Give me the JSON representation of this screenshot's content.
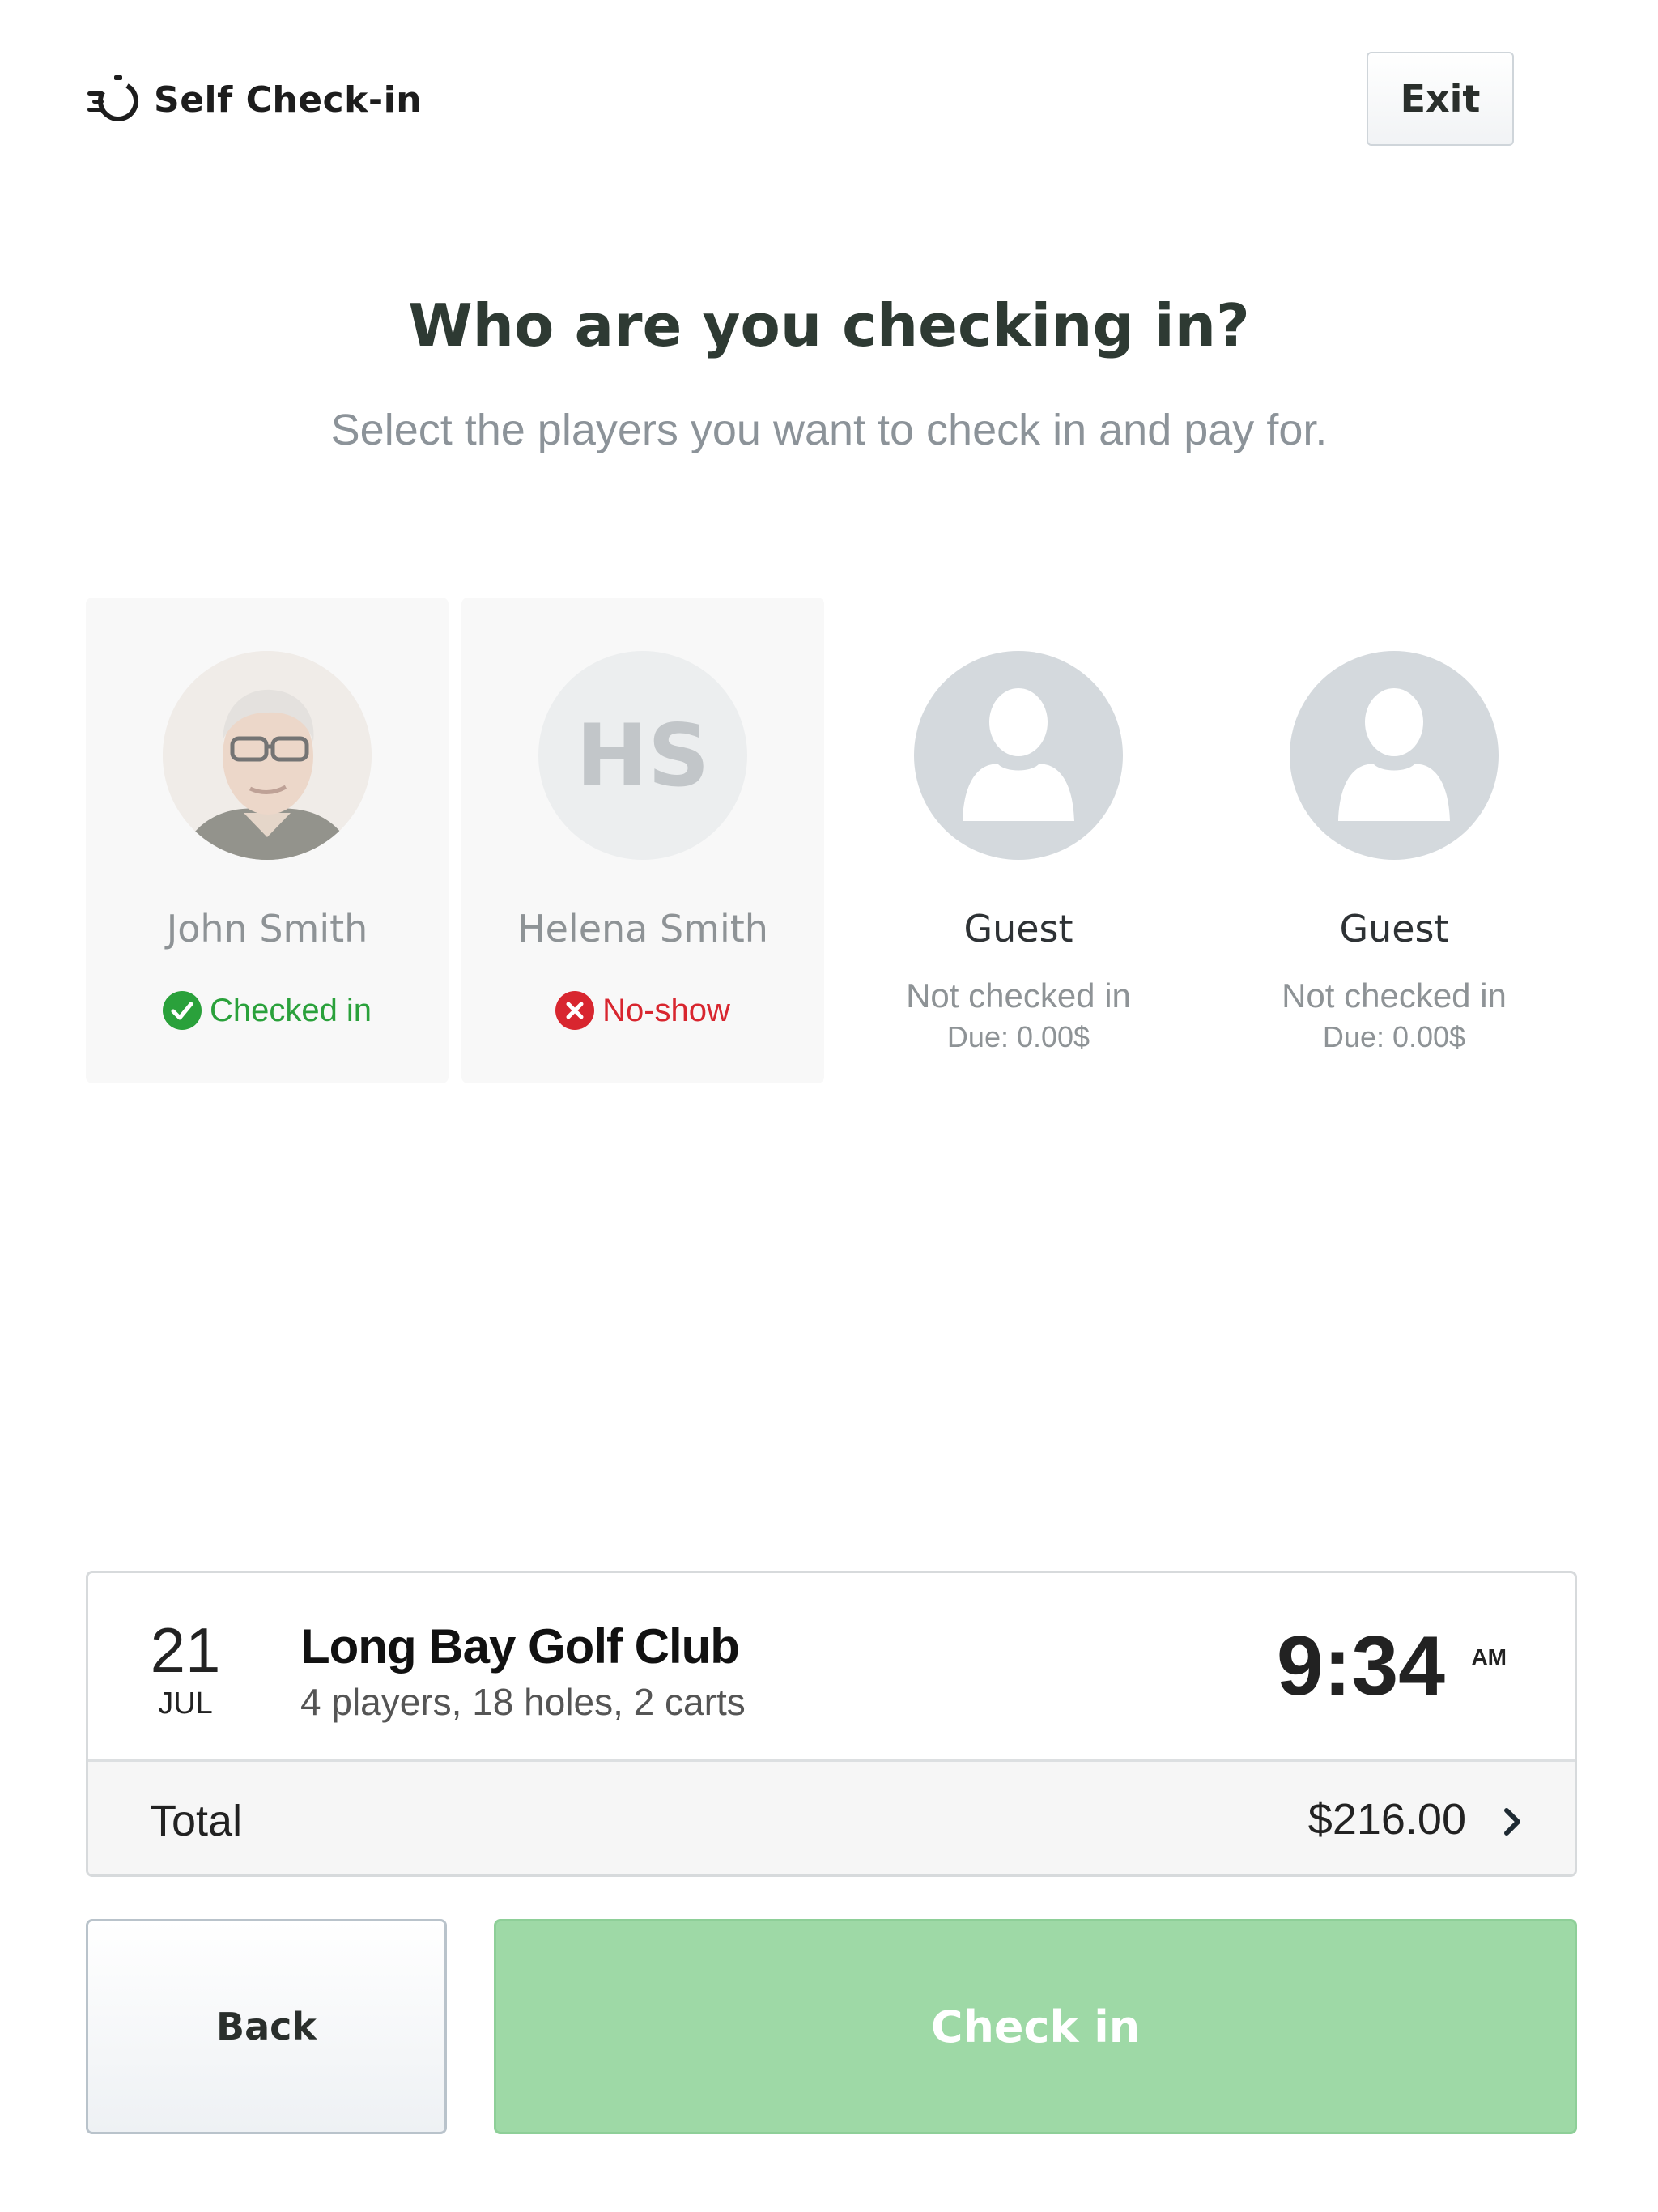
{
  "header": {
    "brand_icon": "stopwatch-speed-icon",
    "brand_label": "Self Check-in",
    "exit_label": "Exit"
  },
  "main": {
    "title": "Who are you checking in?",
    "subtitle": "Select the players you want to check in and pay for."
  },
  "players": [
    {
      "name": "John Smith",
      "avatar": "photo",
      "status": "Checked in",
      "status_icon": "check-circle-icon",
      "status_color": "#2aa13b"
    },
    {
      "name": "Helena Smith",
      "avatar_initials": "HS",
      "status": "No-show",
      "status_icon": "x-circle-icon",
      "status_color": "#d8262f"
    },
    {
      "name": "Guest",
      "avatar_icon": "person-placeholder-icon",
      "status": "Not checked in",
      "due": "Due: 0.00$"
    },
    {
      "name": "Guest",
      "avatar_icon": "person-placeholder-icon",
      "status": "Not checked in",
      "due": "Due: 0.00$"
    }
  ],
  "booking": {
    "day": "21",
    "month": "JUL",
    "club": "Long Bay Golf Club",
    "details": "4 players, 18 holes, 2 carts",
    "time": "9:34",
    "ampm": "AM",
    "total_label": "Total",
    "total_amount": "$216.00"
  },
  "actions": {
    "back_label": "Back",
    "checkin_label": "Check in",
    "checkin_color": "#9ed9a6"
  }
}
